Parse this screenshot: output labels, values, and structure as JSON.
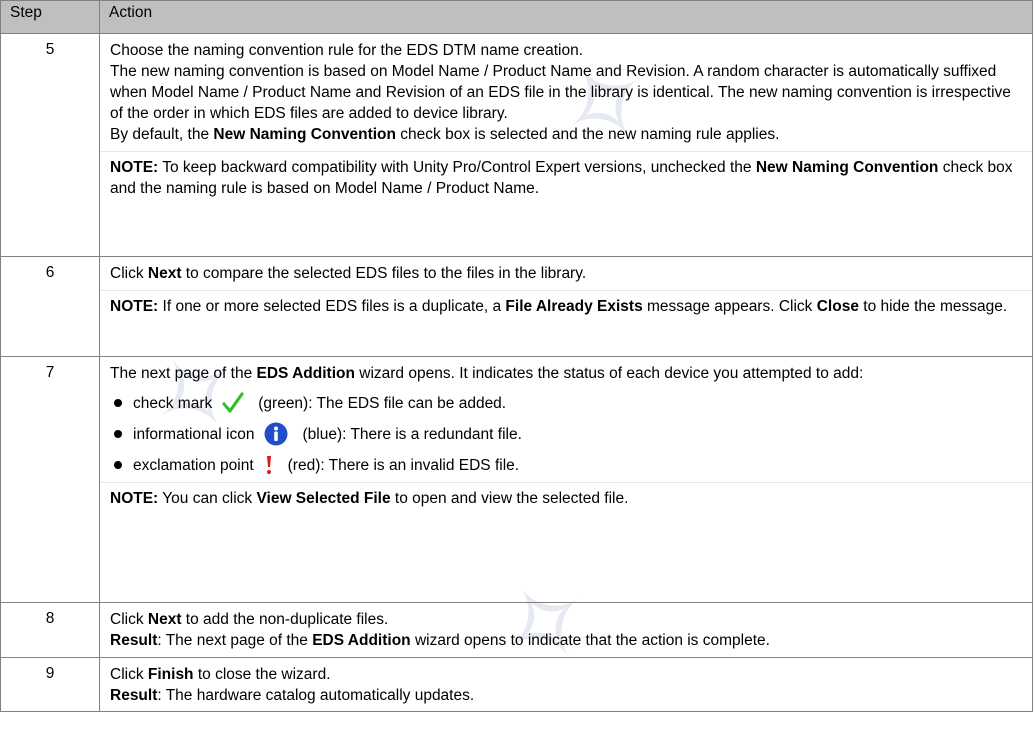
{
  "header": {
    "step": "Step",
    "action": "Action"
  },
  "rows": [
    {
      "step": "5",
      "p1": "Choose the naming convention rule for the EDS DTM name creation.",
      "p2": "The new naming convention is based on Model Name / Product Name and Revision. A random character is automatically suffixed when Model Name / Product Name and Revision of an EDS file in the library is identical. The new naming convention is irrespective of the order in which EDS files are added to device library.",
      "p3_a": "By default, the ",
      "p3_b": "New Naming Convention",
      "p3_c": " check box is selected and the new naming rule applies.",
      "note_label": "NOTE:",
      "note_a": " To keep backward compatibility with Unity Pro/Control Expert versions, unchecked the ",
      "note_b": "New Naming Convention",
      "note_c": " check box and the naming rule is based on Model Name / Product Name."
    },
    {
      "step": "6",
      "p1_a": "Click ",
      "p1_b": "Next",
      "p1_c": " to compare the selected EDS files to the files in the library.",
      "note_label": "NOTE:",
      "note_a": " If one or more selected EDS files is a duplicate, a ",
      "note_b": "File Already Exists",
      "note_c": " message appears. Click ",
      "note_d": "Close",
      "note_e": " to hide the message."
    },
    {
      "step": "7",
      "p1_a": "The next page of the ",
      "p1_b": "EDS Addition",
      "p1_c": " wizard opens. It indicates the status of each device you attempted to add:",
      "bullets": [
        {
          "label": "check mark",
          "icon": "check-icon",
          "text": "(green): The EDS file can be added."
        },
        {
          "label": "informational icon",
          "icon": "info-icon",
          "text": "(blue): There is a redundant file."
        },
        {
          "label": "exclamation point",
          "icon": "exclamation-icon",
          "text": "(red): There is an invalid EDS file."
        }
      ],
      "note_label": "NOTE:",
      "note_a": " You can click ",
      "note_b": "View Selected File",
      "note_c": " to open and view the selected file."
    },
    {
      "step": "8",
      "p1_a": "Click ",
      "p1_b": "Next",
      "p1_c": " to add the non-duplicate files.",
      "result_label": "Result",
      "result_a": ": The next page of the ",
      "result_b": "EDS Addition",
      "result_c": " wizard opens to indicate that the action is complete."
    },
    {
      "step": "9",
      "p1_a": "Click ",
      "p1_b": "Finish",
      "p1_c": " to close the wizard.",
      "result_label": "Result",
      "result_a": ": The hardware catalog automatically updates."
    }
  ],
  "colors": {
    "header_bg": "#bfbfbf",
    "check": "#2fbf2f",
    "info": "#1f4fc9",
    "exclamation": "#e01b1b"
  }
}
